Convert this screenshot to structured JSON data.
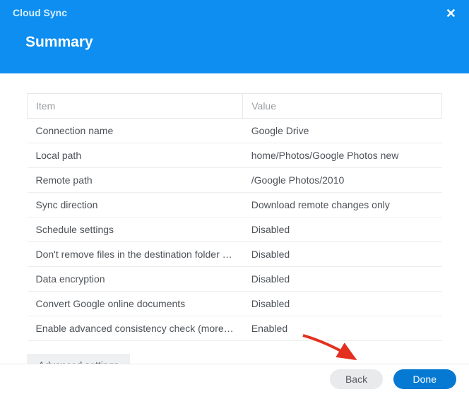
{
  "app_title": "Cloud Sync",
  "page_title": "Summary",
  "columns": {
    "item": "Item",
    "value": "Value"
  },
  "rows": [
    {
      "item": "Connection name",
      "value": "Google Drive"
    },
    {
      "item": "Local path",
      "value": "home/Photos/Google Photos new"
    },
    {
      "item": "Remote path",
      "value": "/Google Photos/2010"
    },
    {
      "item": "Sync direction",
      "value": "Download remote changes only"
    },
    {
      "item": "Schedule settings",
      "value": "Disabled"
    },
    {
      "item": "Don't remove files in the destination folder when they are removed in the source folder",
      "value": "Disabled"
    },
    {
      "item": "Data encryption",
      "value": "Disabled"
    },
    {
      "item": "Convert Google online documents",
      "value": "Disabled"
    },
    {
      "item": "Enable advanced consistency check (more system resources required)",
      "value": "Enabled"
    }
  ],
  "buttons": {
    "advanced": "Advanced settings",
    "back": "Back",
    "done": "Done"
  }
}
